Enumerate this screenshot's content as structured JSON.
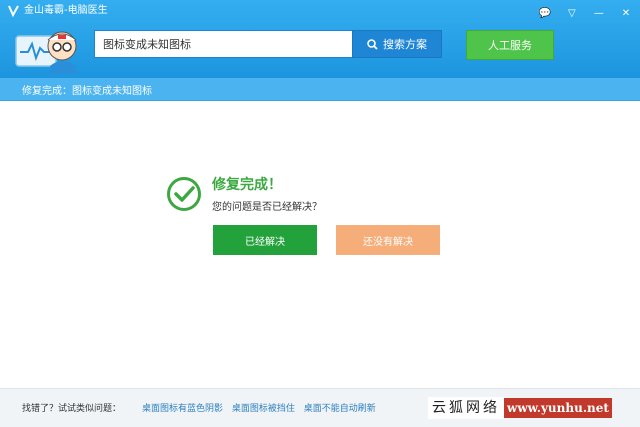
{
  "window": {
    "title": "金山毒霸-电脑医生"
  },
  "search": {
    "value": "图标变成未知图标",
    "button_label": "搜索方案"
  },
  "human_service": {
    "label": "人工服务"
  },
  "breadcrumb": {
    "text": "修复完成：图标变成未知图标"
  },
  "result": {
    "title": "修复完成！",
    "question": "您的问题是否已经解决？",
    "solved_label": "已经解决",
    "unsolved_label": "还没有解决"
  },
  "footer": {
    "label": "找错了？试试类似问题：",
    "links": [
      "桌面图标有蓝色阴影",
      "桌面图标被挡住",
      "桌面不能自动刷新"
    ]
  },
  "watermark": {
    "left": "云狐网络",
    "right": "www.yunhu.net"
  },
  "colors": {
    "header": "#1d95de",
    "primary_green": "#23a13b",
    "secondary_orange": "#f5ad7a",
    "check_green": "#3da842",
    "link_blue": "#2d7fc0"
  }
}
